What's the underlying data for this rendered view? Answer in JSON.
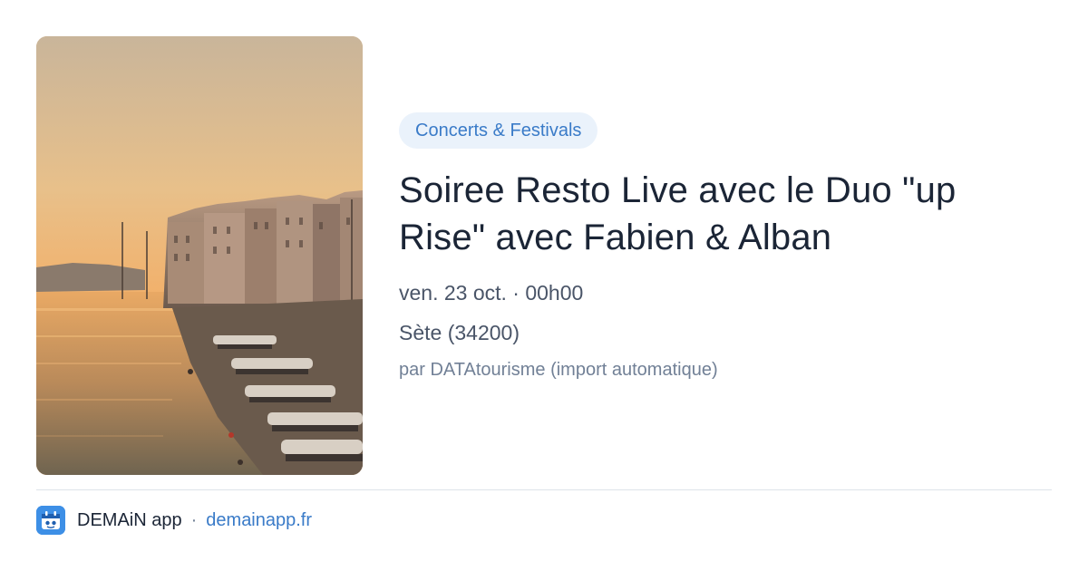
{
  "event": {
    "image_alt": "Sète harbour canal at sunset",
    "category": "Concerts & Festivals",
    "title": "Soiree Resto Live avec le Duo \"up Rise\" avec Fabien & Alban",
    "date": "ven. 23 oct. · 00h00",
    "location": "Sète (34200)",
    "source": "par DATAtourisme (import automatique)"
  },
  "footer": {
    "app_name": "DEMAiN app",
    "separator": "·",
    "link": "demainapp.fr"
  },
  "colors": {
    "accent": "#3a7bc8",
    "chip_bg": "#eaf2fb",
    "title": "#1b2536",
    "logo": "#3d8fe6"
  }
}
